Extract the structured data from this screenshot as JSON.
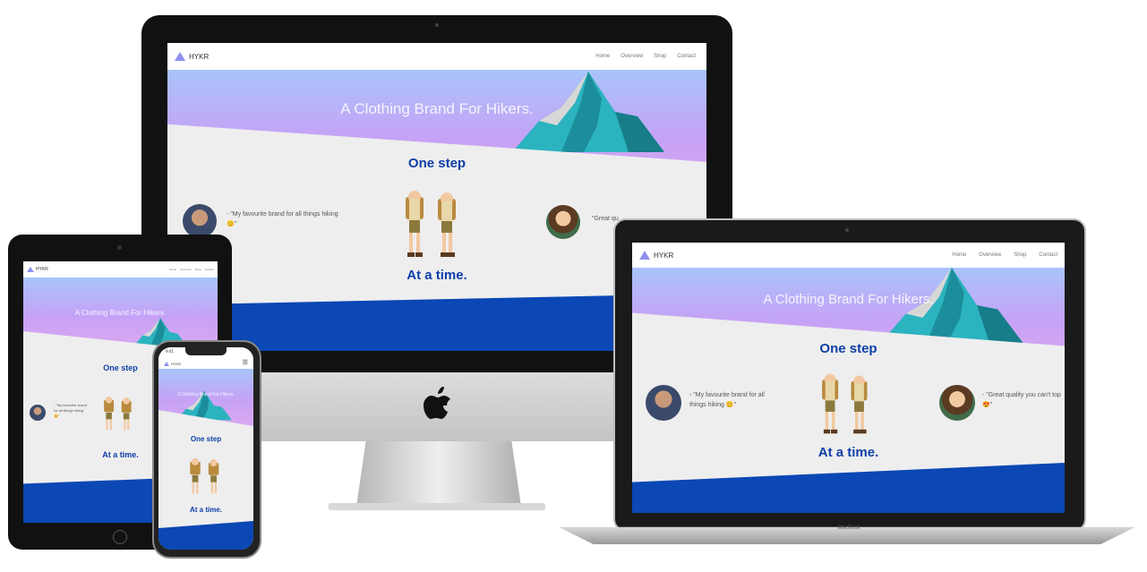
{
  "brand": "HYKR",
  "menu": [
    "Home",
    "Overview",
    "Shop",
    "Contact"
  ],
  "hero_title": "A Clothing Brand For Hikers.",
  "section_top": "One step",
  "section_bottom": "At a time.",
  "quote1": "- \"My favourite brand for all things hiking 😊\"",
  "quote2": "- \"Great quality you can't top 😍\"",
  "quote2_partial": "\"Great qu",
  "laptop_label": "MacBook",
  "phone_time": "9:41",
  "colors": {
    "accent": "#0f40a8",
    "blue": "#0b47b5",
    "hero_top": "#a8c4fa",
    "hero_bottom": "#dca8f0",
    "mountain": "#2bb3bf"
  }
}
